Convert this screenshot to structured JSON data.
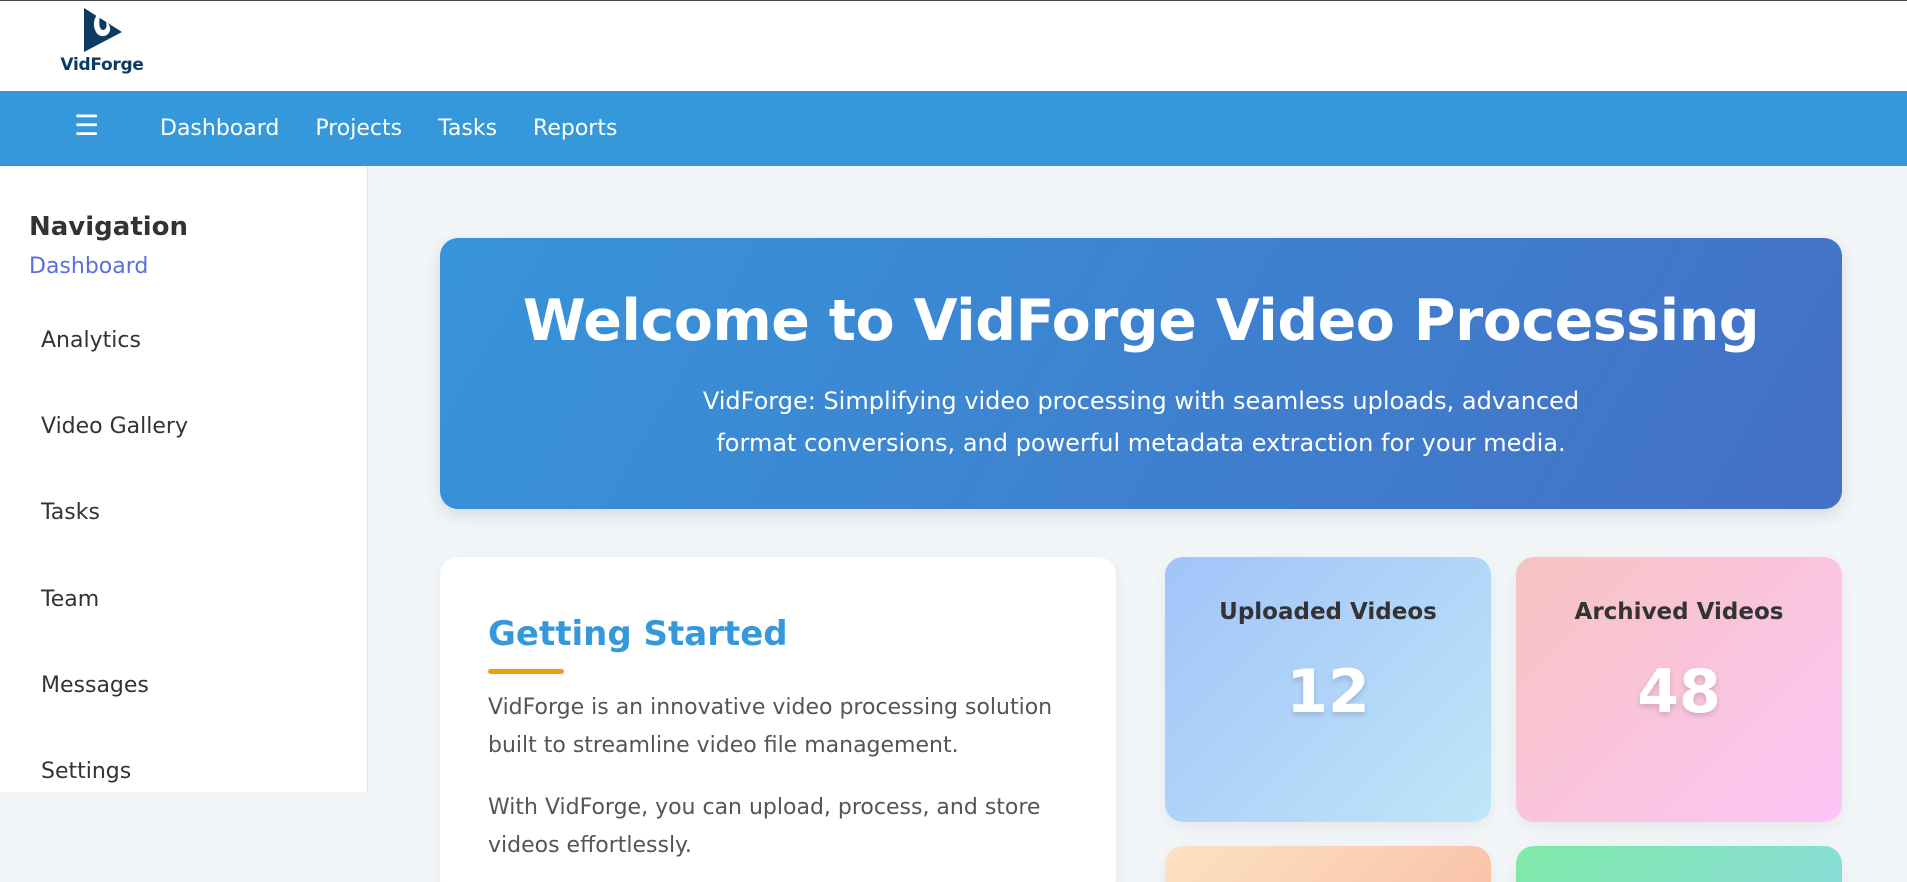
{
  "brand": {
    "name": "VidForge",
    "logo_icon": "flame-play-logo",
    "color": "#0d3a63"
  },
  "navbar": {
    "menu_icon": "hamburger-icon",
    "menu_glyph": "☰",
    "links": [
      "Dashboard",
      "Projects",
      "Tasks",
      "Reports"
    ],
    "color": "#3498db"
  },
  "sidebar": {
    "title": "Navigation",
    "active": "Dashboard",
    "items": [
      "Analytics",
      "Video Gallery",
      "Tasks",
      "Team",
      "Messages",
      "Settings"
    ]
  },
  "hero": {
    "title": "Welcome to VidForge Video Processing",
    "subtitle": "VidForge: Simplifying video processing with seamless uploads, advanced format conversions, and powerful metadata extraction for your media."
  },
  "getting_started": {
    "title": "Getting Started",
    "p1": "VidForge is an innovative video processing solution built to streamline video file management.",
    "p2": "With VidForge, you can upload, process, and store videos effortlessly."
  },
  "stats": [
    {
      "label": "Uploaded Videos",
      "value": "12"
    },
    {
      "label": "Archived Videos",
      "value": "48"
    }
  ],
  "colors": {
    "accent": "#3498db",
    "underline": "#f39c12",
    "sidebar_active": "#5b6ee1"
  }
}
